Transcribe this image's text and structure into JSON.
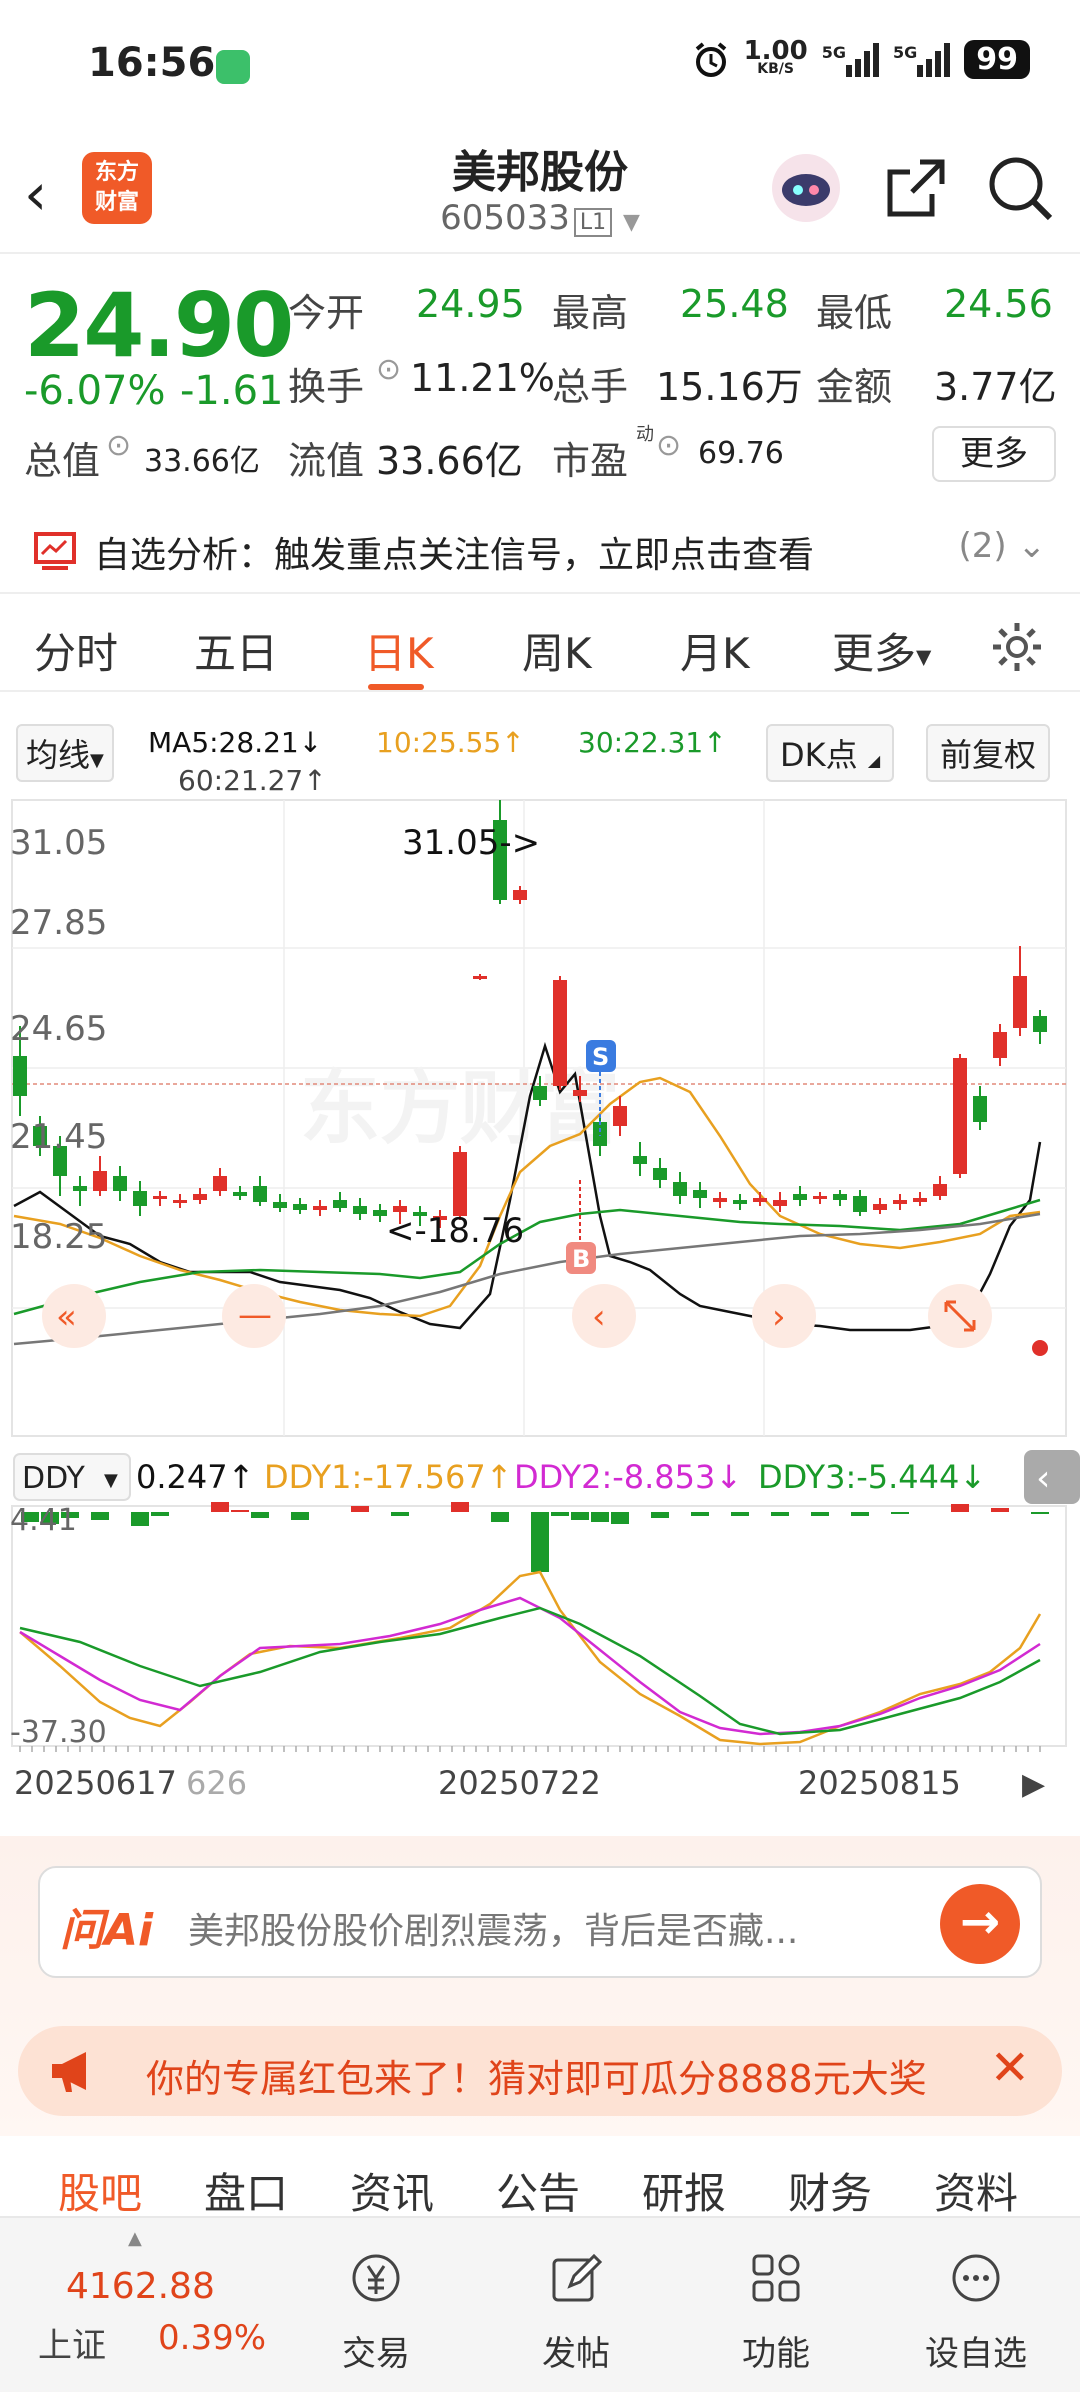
{
  "status": {
    "time": "16:56",
    "speed": "1.00",
    "speed_unit": "KB/S",
    "net1": "5G",
    "net2": "5G",
    "battery": "99"
  },
  "header": {
    "logo": "东方\n财富",
    "logo_line1": "东方",
    "logo_line2": "财富",
    "title": "美邦股份",
    "code": "605033",
    "level": "L1"
  },
  "quote": {
    "price": "24.90",
    "change_pct": "-6.07%",
    "change": "-1.61",
    "open_label": "今开",
    "open": "24.95",
    "high_label": "最高",
    "high": "25.48",
    "low_label": "最低",
    "low": "24.56",
    "turnover_label": "换手",
    "turnover": "11.21%",
    "volume_label": "总手",
    "volume": "15.16万",
    "amount_label": "金额",
    "amount": "3.77亿",
    "mcap_label": "总值",
    "mcap": "33.66亿",
    "float_label": "流值",
    "float": "33.66亿",
    "pe_label": "市盈",
    "pe_sup": "动",
    "pe": "69.76",
    "more": "更多"
  },
  "alert": {
    "text": "自选分析：触发重点关注信号，立即点击查看",
    "count": "(2)"
  },
  "tabs": [
    "分时",
    "五日",
    "日K",
    "周K",
    "月K",
    "更多"
  ],
  "ma": {
    "btn": "均线",
    "ma5": "MA5:28.21↓",
    "ma10": "10:25.55↑",
    "ma30": "30:22.31↑",
    "ma60": "60:21.27↑",
    "dk": "DK点",
    "adj": "前复权"
  },
  "chart_labels": {
    "y_top": "31.05",
    "y2": "27.85",
    "y3": "24.65",
    "y4": "21.45",
    "y_bot": "18.25",
    "max_mark": "31.05->",
    "min_mark": "<-18.76",
    "sig_s": "S",
    "sig_b": "B",
    "watermark": "东方财富"
  },
  "ddy": {
    "btn": "DDY",
    "val": "0.247↑",
    "ddy1": "DDY1:-17.567↑",
    "ddy2": "DDY2:-8.853↓",
    "ddy3": "DDY3:-5.444↓",
    "y_top": "4.41",
    "y_bot": "-37.30"
  },
  "dates": {
    "d1": "20250617",
    "d1b": "626",
    "d2": "20250722",
    "d3": "20250815"
  },
  "colors": {
    "up": "#e0302a",
    "down": "#1a9a2a",
    "accent": "#f05a28",
    "ma5": "#111111",
    "ma10": "#e8a020",
    "ma30": "#1a9a2a",
    "ma60": "#777777",
    "ddy2": "#d22ad2"
  },
  "ai": {
    "logo": "问Ai",
    "question": "美邦股份股价剧烈震荡，背后是否藏...",
    "go": "→"
  },
  "banner": {
    "text": "你的专属红包来了！猜对即可瓜分8888元大奖",
    "close": "✕"
  },
  "subtabs": [
    "股吧",
    "盘口",
    "资讯",
    "公告",
    "研报",
    "财务",
    "资料"
  ],
  "bottom": {
    "index_value": "4162.88",
    "index_name": "上证",
    "index_pct": "0.39%",
    "nav": [
      "交易",
      "发帖",
      "功能",
      "设自选"
    ]
  }
}
